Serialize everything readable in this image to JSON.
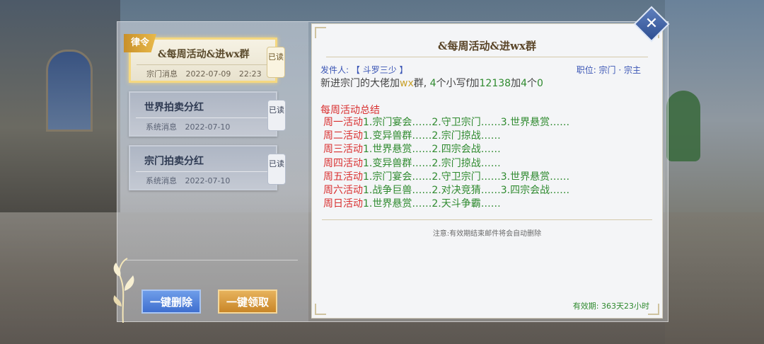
{
  "mail_list": [
    {
      "title": "&每周活动&进wx群",
      "meta": "宗门消息 2022-07-09 22:23",
      "read_label": "已读",
      "ribbon": "律令",
      "selected": true
    },
    {
      "title": "世界拍卖分红",
      "meta": "系统消息 2022-07-10",
      "read_label": "已读"
    },
    {
      "title": "宗门拍卖分红",
      "meta": "系统消息 2022-07-10",
      "read_label": "已读"
    }
  ],
  "buttons": {
    "delete_all": "一键删除",
    "claim_all": "一键领取"
  },
  "detail": {
    "title": "&每周活动&进wx群",
    "sender_label": "发件人:",
    "sender_name": "【 斗罗三少 】",
    "position": "职位: 宗门 · 宗主",
    "line1": [
      {
        "t": "新进宗门的大佬加",
        "c": "n"
      },
      {
        "t": "wx",
        "c": "o"
      },
      {
        "t": "群, ",
        "c": "n"
      },
      {
        "t": "4",
        "c": "g"
      },
      {
        "t": "个小写f加",
        "c": "n"
      },
      {
        "t": "12138",
        "c": "g"
      },
      {
        "t": "加",
        "c": "n"
      },
      {
        "t": "4",
        "c": "g"
      },
      {
        "t": "个",
        "c": "n"
      },
      {
        "t": "0",
        "c": "g"
      }
    ],
    "summary_title": "每周活动总结",
    "schedule": [
      {
        "day": "周一活动",
        "acts": "1.宗门宴会……2.守卫宗门……3.世界悬赏……"
      },
      {
        "day": "周二活动",
        "acts": "1.变异兽群……2.宗门掠战……"
      },
      {
        "day": "周三活动",
        "acts": "1.世界悬赏……2.四宗会战……"
      },
      {
        "day": "周四活动",
        "acts": "1.变异兽群……2.宗门掠战……"
      },
      {
        "day": "周五活动",
        "acts": "1.宗门宴会……2.守卫宗门……3.世界悬赏……"
      },
      {
        "day": "周六活动",
        "acts": "1.战争巨兽……2.对决竞猜……3.四宗会战……"
      },
      {
        "day": "周日活动",
        "acts": "1.世界悬赏……2.天斗争霸……"
      }
    ],
    "note": "注意:有效期结束邮件将会自动删除",
    "validity": "有效期: 363天23小时"
  },
  "icons": {
    "close": "close-x-icon",
    "flower": "decorative-flower-icon"
  }
}
